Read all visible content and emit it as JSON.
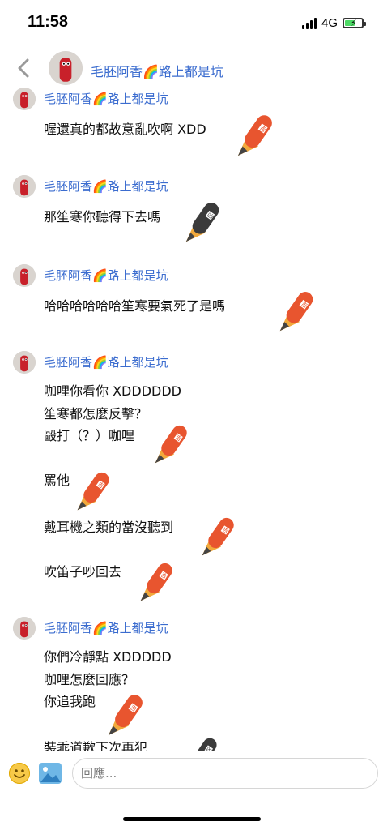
{
  "status": {
    "time": "11:58",
    "network": "4G"
  },
  "header": {
    "title": "毛胚阿香🌈路上都是坑"
  },
  "messages": [
    {
      "name": "毛胚阿香🌈路上都是坑",
      "lines": [
        "喔還真的都故意亂吹啊 XDD"
      ]
    },
    {
      "name": "毛胚阿香🌈路上都是坑",
      "lines": [
        "那笙寒你聽得下去嗎"
      ]
    },
    {
      "name": "毛胚阿香🌈路上都是坑",
      "lines": [
        "哈哈哈哈哈哈笙寒要氣死了是嗎"
      ]
    },
    {
      "name": "毛胚阿香🌈路上都是坑",
      "lines": [
        "咖哩你看你 XDDDDDD",
        "笙寒都怎麼反擊？",
        "毆打（？）咖哩",
        "罵他",
        "戴耳機之類的當沒聽到",
        "吹笛子吵回去"
      ]
    },
    {
      "name": "毛胚阿香🌈路上都是坑",
      "lines": [
        "你們冷靜點 XDDDDD",
        "咖哩怎麼回應？",
        "你追我跑",
        "裝乖道歉下次再犯"
      ]
    }
  ],
  "stickers": [
    {
      "type": "大吉",
      "color": "#e8552f"
    },
    {
      "type": "小凶",
      "color": "#3b3b3b"
    }
  ],
  "input": {
    "placeholder": "回應..."
  },
  "icons": {
    "back": "chevron-left-icon",
    "emoji": "smiley-icon",
    "photo": "image-icon"
  }
}
